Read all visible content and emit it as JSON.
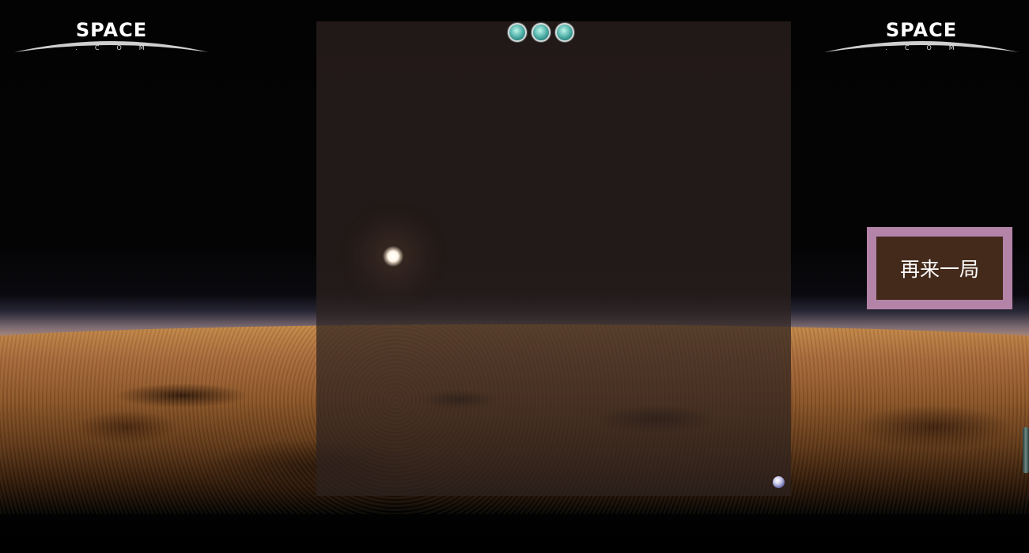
{
  "logo": {
    "word": "SPACE",
    "sub": ".COM"
  },
  "game": {
    "lives_remaining": 3,
    "restart_label": "再来一局"
  },
  "colors": {
    "restart_border": "#b383a8",
    "restart_fill": "#442a1b",
    "life_ball": "#6ec5bb",
    "game_ball": "#6d6fae"
  }
}
